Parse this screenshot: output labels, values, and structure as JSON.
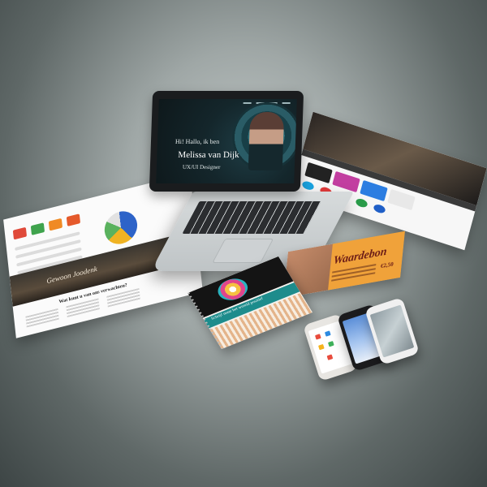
{
  "laptop": {
    "hero_greeting": "Hi! Hallo, ik ben",
    "hero_name": "Melissa van Dijk",
    "hero_role": "UX/UI Designer"
  },
  "left_web": {
    "banner_text": "Gewoon Joodenk",
    "section_title": "Wat kunt u van ons verwachten?"
  },
  "notebook": {
    "band_text": "Schrijf maar het wereld positief"
  },
  "voucher": {
    "title": "Waardebon",
    "price": "€2,50"
  },
  "colors": {
    "background_center": "#c9cfce",
    "background_edge": "#3d4545",
    "laptop_screen": "#14262b",
    "accent_teal": "#1d8c8c",
    "voucher_orange": "#f0a23a"
  }
}
